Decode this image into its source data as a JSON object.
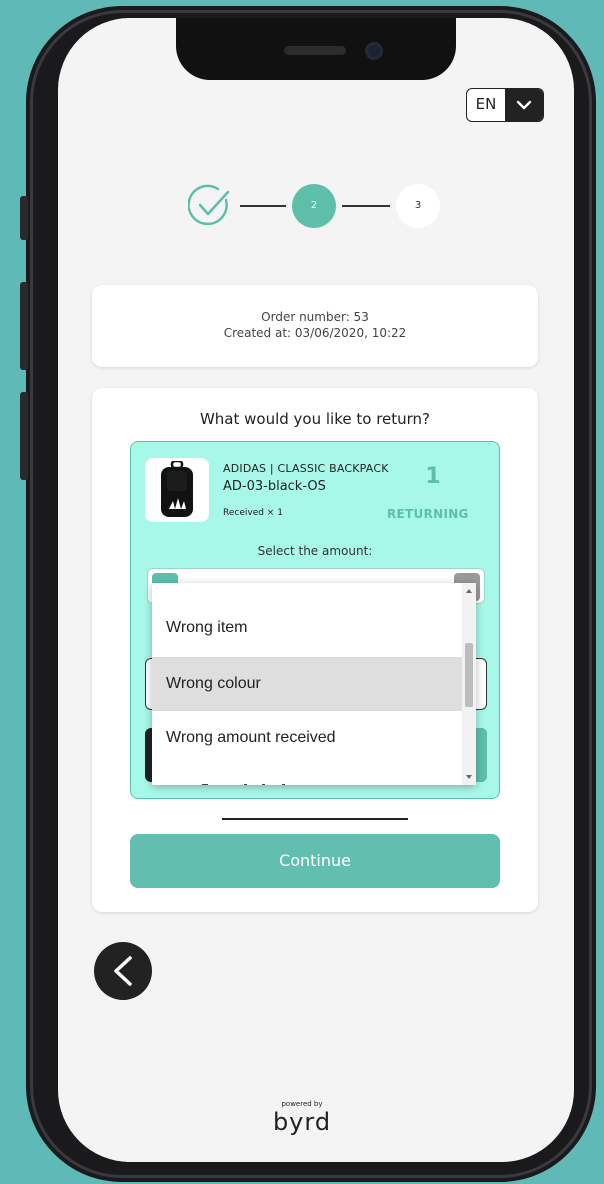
{
  "language": {
    "code": "EN"
  },
  "stepper": {
    "step2": "2",
    "step3": "3"
  },
  "order": {
    "number_line": "Order number: 53",
    "created_line": "Created at: 03/06/2020, 10:22"
  },
  "return_form": {
    "question": "What would you like to return?",
    "item": {
      "brand_name": "ADIDAS | CLASSIC BACKPACK",
      "sku": "AD-03-black-OS",
      "received": "Received × 1",
      "returning_count": "1",
      "returning_label": "RETURNING"
    },
    "select_amount_label": "Select the amount:",
    "continue_label": "Continue"
  },
  "reason_dropdown": {
    "options": [
      "Wrong item",
      "Wrong colour",
      "Wrong amount received"
    ],
    "highlighted": "Wrong colour",
    "highlight_color": "#dedede"
  },
  "footer": {
    "powered_by": "powered by",
    "logo": "byrd"
  },
  "colors": {
    "accent": "#5dbfaa",
    "item_background": "#a8f8ea",
    "page_background": "#5fbab7"
  }
}
